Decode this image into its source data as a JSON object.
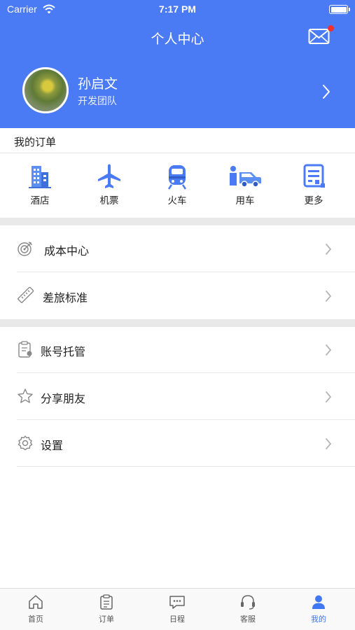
{
  "status_bar": {
    "carrier": "Carrier",
    "time": "7:17 PM"
  },
  "header": {
    "title": "个人中心"
  },
  "profile": {
    "name": "孙启文",
    "team": "开发团队"
  },
  "orders": {
    "title": "我的订单",
    "items": [
      {
        "label": "酒店",
        "icon": "hotel-icon"
      },
      {
        "label": "机票",
        "icon": "plane-icon"
      },
      {
        "label": "火车",
        "icon": "train-icon"
      },
      {
        "label": "用车",
        "icon": "car-icon"
      },
      {
        "label": "更多",
        "icon": "more-icon"
      }
    ]
  },
  "menu": {
    "group1": [
      {
        "label": "成本中心",
        "icon": "target-icon"
      },
      {
        "label": "差旅标准",
        "icon": "ruler-icon"
      }
    ],
    "group2": [
      {
        "label": "账号托管",
        "icon": "clipboard-icon"
      },
      {
        "label": "分享朋友",
        "icon": "star-icon"
      },
      {
        "label": "设置",
        "icon": "gear-icon"
      }
    ]
  },
  "tabbar": {
    "items": [
      {
        "label": "首页",
        "icon": "home-icon"
      },
      {
        "label": "订单",
        "icon": "order-list-icon"
      },
      {
        "label": "日程",
        "icon": "chat-icon"
      },
      {
        "label": "客服",
        "icon": "headset-icon"
      },
      {
        "label": "我的",
        "icon": "user-icon"
      }
    ],
    "active_index": 4
  },
  "colors": {
    "primary": "#4a7af4",
    "tab_active": "#3f78f2",
    "badge": "#f23030"
  }
}
